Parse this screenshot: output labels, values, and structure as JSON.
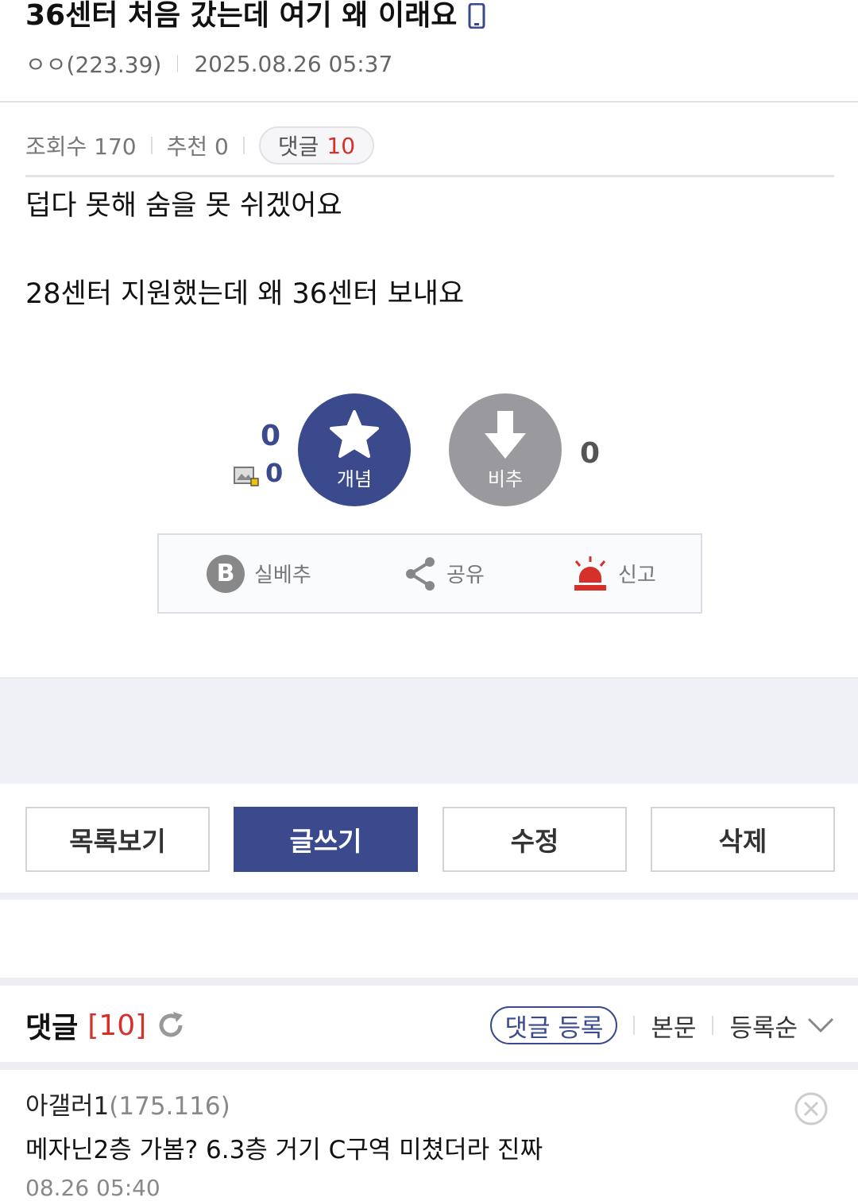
{
  "post": {
    "title": "36센터 처음 갔는데 여기 왜 이래요",
    "author": "ㅇㅇ(223.39)",
    "date": "2025.08.26 05:37",
    "views_label": "조회수 170",
    "recommend_label": "추천 0",
    "comment_label": "댓글",
    "comment_count": "10",
    "body": [
      "덥다 못해 숨을 못 쉬겠어요",
      "28센터 지원했는데 왜 36센터 보내요"
    ]
  },
  "votes": {
    "up_count": "0",
    "fixed_up_count": "0",
    "up_label": "개념",
    "down_label": "비추",
    "down_count": "0"
  },
  "actions": {
    "best_label": "실베추",
    "share_label": "공유",
    "report_label": "신고"
  },
  "buttons": {
    "list": "목록보기",
    "write": "글쓰기",
    "edit": "수정",
    "delete": "삭제"
  },
  "comments": {
    "title": "댓글",
    "count": "[10]",
    "register": "댓글 등록",
    "body_link": "본문",
    "sort": "등록순",
    "items": [
      {
        "author": "아갤러1",
        "ip": "(175.116)",
        "text": "메자닌2층 가봄? 6.3층 거기 C구역 미쳤더라 진짜",
        "date": "08.26 05:40"
      }
    ]
  },
  "colors": {
    "accent": "#3a4a8c",
    "red": "#d6302a",
    "downvote": "#9a9a9e"
  },
  "icons": [
    "phone-icon",
    "star-icon",
    "down-arrow-icon",
    "image-fix-icon",
    "b-icon",
    "share-icon",
    "siren-icon",
    "refresh-icon",
    "chevron-down-icon",
    "close-circle-icon"
  ]
}
